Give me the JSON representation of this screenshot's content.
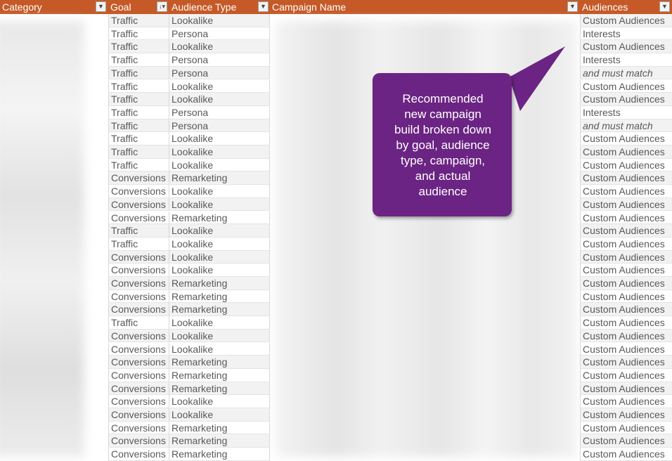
{
  "header": {
    "columns": [
      {
        "label": "Category",
        "filter_icon": "dropdown-arrow"
      },
      {
        "label": "Goal",
        "filter_icon": "sort-filter"
      },
      {
        "label": "Audience Type",
        "filter_icon": "dropdown-arrow"
      },
      {
        "label": "Campaign Name",
        "filter_icon": "dropdown-arrow"
      },
      {
        "label": "Audiences",
        "filter_icon": "dropdown-arrow"
      }
    ],
    "color": "#c55a28"
  },
  "rows": [
    {
      "goal": "Traffic",
      "audience_type": "Lookalike",
      "audiences": "Custom Audiences"
    },
    {
      "goal": "Traffic",
      "audience_type": "Persona",
      "audiences": "Interests"
    },
    {
      "goal": "Traffic",
      "audience_type": "Lookalike",
      "audiences": "Custom Audiences"
    },
    {
      "goal": "Traffic",
      "audience_type": "Persona",
      "audiences": "Interests"
    },
    {
      "goal": "Traffic",
      "audience_type": "Persona",
      "audiences": "and must match",
      "italic": true
    },
    {
      "goal": "Traffic",
      "audience_type": "Lookalike",
      "audiences": "Custom Audiences"
    },
    {
      "goal": "Traffic",
      "audience_type": "Lookalike",
      "audiences": "Custom Audiences"
    },
    {
      "goal": "Traffic",
      "audience_type": "Persona",
      "audiences": "Interests"
    },
    {
      "goal": "Traffic",
      "audience_type": "Persona",
      "audiences": "and must match",
      "italic": true
    },
    {
      "goal": "Traffic",
      "audience_type": "Lookalike",
      "audiences": "Custom Audiences"
    },
    {
      "goal": "Traffic",
      "audience_type": "Lookalike",
      "audiences": "Custom Audiences"
    },
    {
      "goal": "Traffic",
      "audience_type": "Lookalike",
      "audiences": "Custom Audiences"
    },
    {
      "goal": "Conversions",
      "audience_type": "Remarketing",
      "audiences": "Custom Audiences"
    },
    {
      "goal": "Conversions",
      "audience_type": "Lookalike",
      "audiences": "Custom Audiences"
    },
    {
      "goal": "Conversions",
      "audience_type": "Lookalike",
      "audiences": "Custom Audiences"
    },
    {
      "goal": "Conversions",
      "audience_type": "Remarketing",
      "audiences": "Custom Audiences"
    },
    {
      "goal": "Traffic",
      "audience_type": "Lookalike",
      "audiences": "Custom Audiences"
    },
    {
      "goal": "Traffic",
      "audience_type": "Lookalike",
      "audiences": "Custom Audiences"
    },
    {
      "goal": "Conversions",
      "audience_type": "Lookalike",
      "audiences": "Custom Audiences"
    },
    {
      "goal": "Conversions",
      "audience_type": "Lookalike",
      "audiences": "Custom Audiences"
    },
    {
      "goal": "Conversions",
      "audience_type": "Remarketing",
      "audiences": "Custom Audiences"
    },
    {
      "goal": "Conversions",
      "audience_type": "Remarketing",
      "audiences": "Custom Audiences"
    },
    {
      "goal": "Conversions",
      "audience_type": "Remarketing",
      "audiences": "Custom Audiences"
    },
    {
      "goal": "Traffic",
      "audience_type": "Lookalike",
      "audiences": "Custom Audiences"
    },
    {
      "goal": "Conversions",
      "audience_type": "Lookalike",
      "audiences": "Custom Audiences"
    },
    {
      "goal": "Conversions",
      "audience_type": "Lookalike",
      "audiences": "Custom Audiences"
    },
    {
      "goal": "Conversions",
      "audience_type": "Remarketing",
      "audiences": "Custom Audiences"
    },
    {
      "goal": "Conversions",
      "audience_type": "Remarketing",
      "audiences": "Custom Audiences"
    },
    {
      "goal": "Conversions",
      "audience_type": "Remarketing",
      "audiences": "Custom Audiences"
    },
    {
      "goal": "Conversions",
      "audience_type": "Lookalike",
      "audiences": "Custom Audiences"
    },
    {
      "goal": "Conversions",
      "audience_type": "Lookalike",
      "audiences": "Custom Audiences"
    },
    {
      "goal": "Conversions",
      "audience_type": "Remarketing",
      "audiences": "Custom Audiences"
    },
    {
      "goal": "Conversions",
      "audience_type": "Remarketing",
      "audiences": "Custom Audiences"
    },
    {
      "goal": "Conversions",
      "audience_type": "Remarketing",
      "audiences": "Custom Audiences"
    }
  ],
  "callout": {
    "lines": [
      "Recommended",
      "new campaign",
      "build broken down",
      "by goal, audience",
      "type, campaign,",
      "and actual",
      "audience"
    ],
    "color": "#6b2483"
  }
}
